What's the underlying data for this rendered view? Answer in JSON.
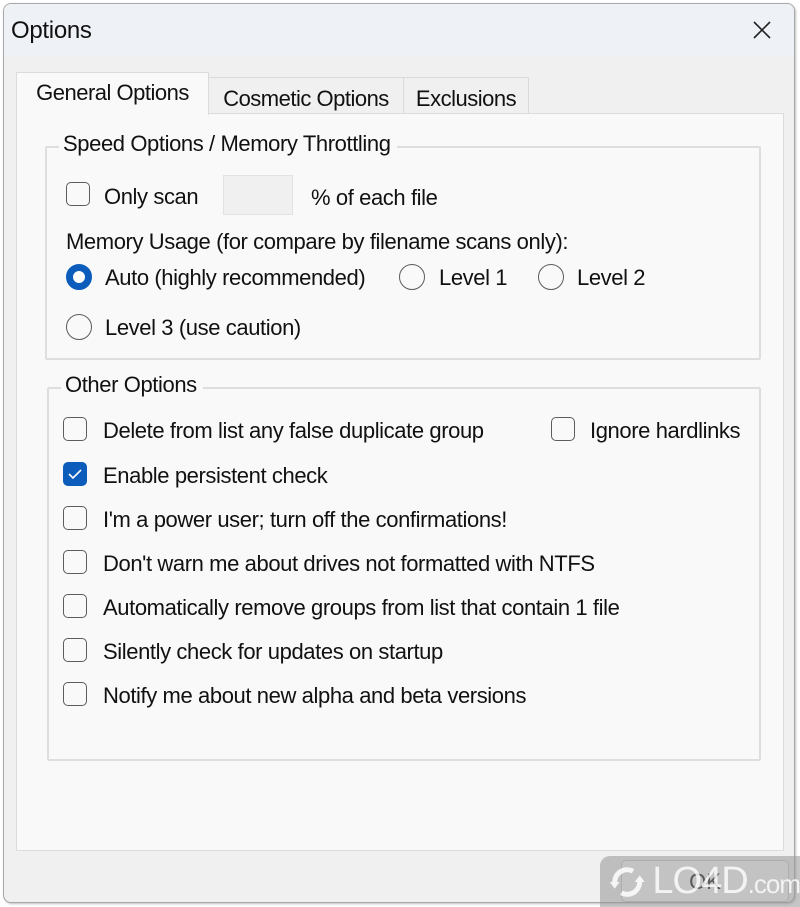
{
  "window": {
    "title": "Options",
    "close_icon": "close-x-icon"
  },
  "tabs": [
    {
      "label": "General Options",
      "active": true
    },
    {
      "label": "Cosmetic Options",
      "active": false
    },
    {
      "label": "Exclusions",
      "active": false
    }
  ],
  "speed": {
    "group_label": "Speed Options / Memory Throttling",
    "only_scan": {
      "label": "Only scan",
      "checked": false
    },
    "percent_value": "",
    "percent_suffix": "% of each file",
    "memory_label": "Memory Usage (for compare by filename scans only):",
    "memory_options": [
      {
        "label": "Auto (highly recommended)",
        "selected": true
      },
      {
        "label": "Level 1",
        "selected": false
      },
      {
        "label": "Level 2",
        "selected": false
      },
      {
        "label": "Level 3 (use caution)",
        "selected": false
      }
    ]
  },
  "other": {
    "group_label": "Other Options",
    "options": [
      {
        "label": "Delete from list any false duplicate group",
        "checked": false
      },
      {
        "label": "Ignore hardlinks",
        "checked": false
      },
      {
        "label": "Enable persistent check",
        "checked": true
      },
      {
        "label": "I'm a power user; turn off the confirmations!",
        "checked": false
      },
      {
        "label": "Don't warn me about drives not formatted with NTFS",
        "checked": false
      },
      {
        "label": "Automatically remove groups from list that contain 1 file",
        "checked": false
      },
      {
        "label": "Silently check for updates on startup",
        "checked": false
      },
      {
        "label": "Notify me about new alpha and beta versions",
        "checked": false
      }
    ]
  },
  "footer": {
    "ok_label": "OK"
  },
  "watermark": {
    "text": "LO4D",
    "suffix": ".com"
  },
  "colors": {
    "accent": "#0b5cbb",
    "panel_bg": "#f9f9f9",
    "window_bg": "#f0f0f0"
  }
}
